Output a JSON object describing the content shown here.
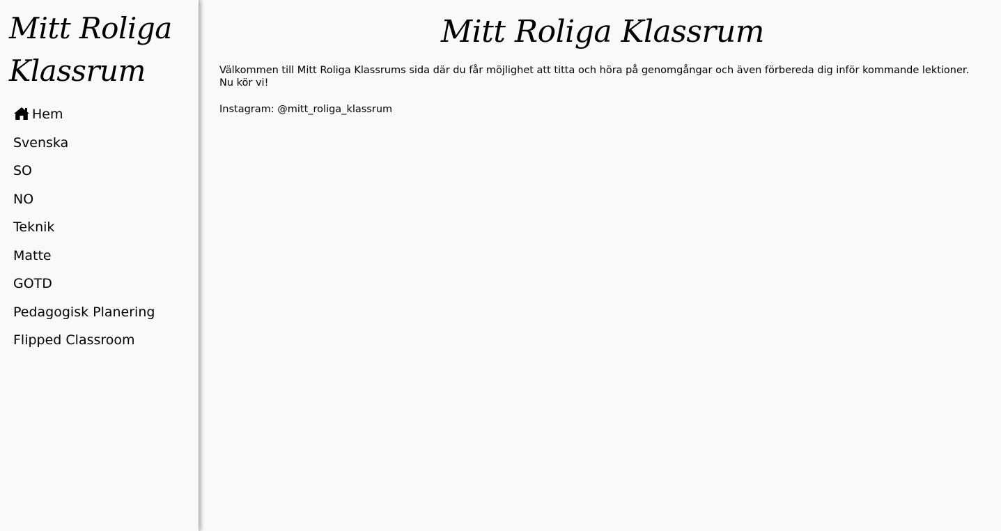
{
  "sidebar": {
    "brand": "Mitt Roliga Klassrum",
    "items": [
      {
        "label": "Hem",
        "icon": "home-icon"
      },
      {
        "label": "Svenska"
      },
      {
        "label": "SO"
      },
      {
        "label": "NO"
      },
      {
        "label": "Teknik"
      },
      {
        "label": "Matte"
      },
      {
        "label": "GOTD"
      },
      {
        "label": "Pedagogisk Planering"
      },
      {
        "label": "Flipped Classroom"
      }
    ]
  },
  "main": {
    "title": "Mitt Roliga Klassrum",
    "welcome_line1": "Välkommen till Mitt Roliga Klassrums sida där du får möjlighet att titta och höra på genomgångar och även förbereda dig inför kommande lektioner.",
    "welcome_line2": "Nu kör vi!",
    "instagram": "Instagram: @mitt_roliga_klassrum"
  }
}
